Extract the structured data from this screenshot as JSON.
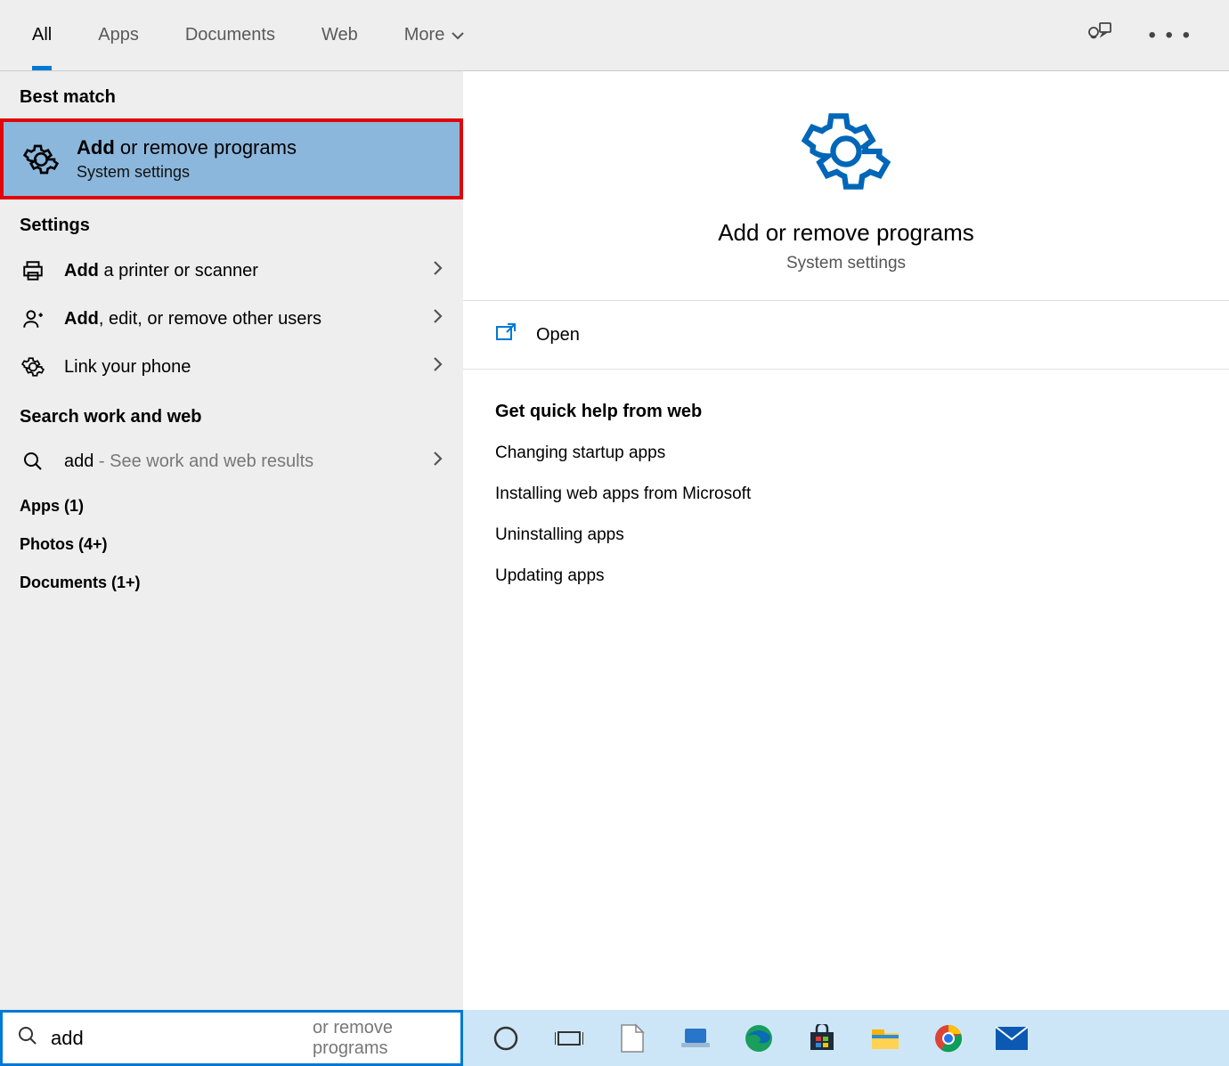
{
  "tabs": {
    "all": "All",
    "apps": "Apps",
    "documents": "Documents",
    "web": "Web",
    "more": "More"
  },
  "sections": {
    "best_match": "Best match",
    "settings": "Settings",
    "search_web": "Search work and web",
    "apps_count": "Apps (1)",
    "photos_count": "Photos (4+)",
    "docs_count": "Documents (1+)"
  },
  "best_match_item": {
    "title_bold": "Add",
    "title_rest": " or remove programs",
    "subtitle": "System settings"
  },
  "settings_items": {
    "printer_bold": "Add",
    "printer_rest": " a printer or scanner",
    "users_bold": "Add",
    "users_rest": ", edit, or remove other users",
    "phone": "Link your phone"
  },
  "web_item": {
    "bold": "add",
    "rest": " - See work and web results"
  },
  "preview": {
    "title": "Add or remove programs",
    "subtitle": "System settings",
    "open": "Open",
    "help_title": "Get quick help from web",
    "help1": "Changing startup apps",
    "help2": "Installing web apps from Microsoft",
    "help3": "Uninstalling apps",
    "help4": "Updating apps"
  },
  "search": {
    "value": "add",
    "placeholder": "or remove programs"
  }
}
